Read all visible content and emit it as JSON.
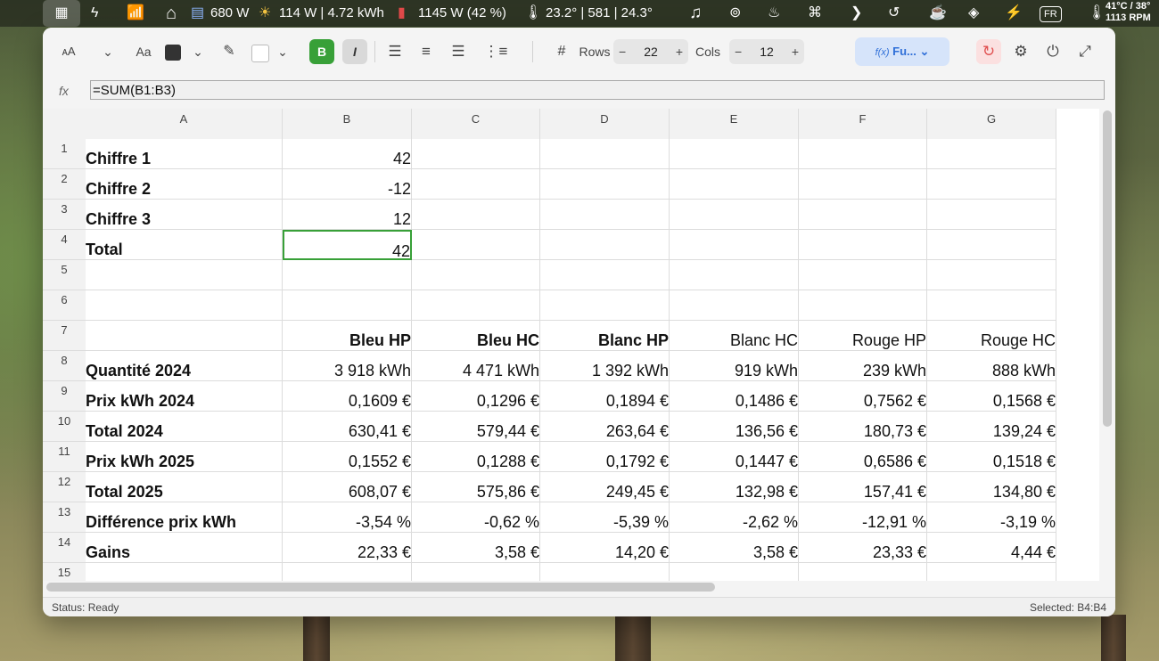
{
  "menubar": {
    "items": [
      {
        "name": "spreadsheet-app-icon",
        "glyph": "▦"
      },
      {
        "name": "slash-app-icon",
        "glyph": "ϟ"
      },
      {
        "name": "wifi-icon",
        "glyph": "📶"
      },
      {
        "name": "solar-house-icon",
        "glyph": "⌂"
      },
      {
        "text": "680 W"
      },
      {
        "name": "sun-icon",
        "glyph": "☀"
      },
      {
        "text": "114 W | 4.72 kWh"
      },
      {
        "name": "battery-icon",
        "glyph": "▮"
      },
      {
        "text": "1145 W (42 %)"
      },
      {
        "name": "thermometer-icon",
        "glyph": "🌡"
      },
      {
        "text": "23.2° | 581 | 24.3°"
      },
      {
        "name": "music-icon",
        "glyph": "♫"
      },
      {
        "name": "radio-icon",
        "glyph": "⊚"
      },
      {
        "name": "flame-icon",
        "glyph": "♨"
      },
      {
        "name": "command-icon",
        "glyph": "⌘"
      },
      {
        "name": "chevron-right-icon",
        "glyph": "❯"
      },
      {
        "name": "history-icon",
        "glyph": "↺"
      },
      {
        "name": "coffee-icon",
        "glyph": "☕"
      },
      {
        "name": "layers-icon",
        "glyph": "◈"
      },
      {
        "name": "bolt-icon",
        "glyph": "⚡"
      }
    ],
    "keyboard_label": "FR",
    "temp_line1": "41°C / 38°",
    "temp_line2": "1113 RPM"
  },
  "toolbar": {
    "font_size_icon": "ᴀA",
    "font_icon": "Aa",
    "text_color": "#333333",
    "fill_color": "#ffffff",
    "bold_label": "B",
    "italic_label": "I",
    "rows_label": "Rows",
    "rows_value": "22",
    "cols_label": "Cols",
    "cols_value": "12",
    "function_label": "Fu...",
    "function_prefix": "f(x)"
  },
  "formula_bar": {
    "label": "fx",
    "value": "=SUM(B1:B3)"
  },
  "grid": {
    "columns": [
      "A",
      "B",
      "C",
      "D",
      "E",
      "F",
      "G"
    ],
    "rows": [
      {
        "n": "1",
        "cells": [
          "Chiffre 1",
          "42",
          "",
          "",
          "",
          "",
          ""
        ]
      },
      {
        "n": "2",
        "cells": [
          "Chiffre 2",
          "-12",
          "",
          "",
          "",
          "",
          ""
        ]
      },
      {
        "n": "3",
        "cells": [
          "Chiffre 3",
          "12",
          "",
          "",
          "",
          "",
          ""
        ]
      },
      {
        "n": "4",
        "cells": [
          "Total",
          "42",
          "",
          "",
          "",
          "",
          ""
        ]
      },
      {
        "n": "5",
        "cells": [
          "",
          "",
          "",
          "",
          "",
          "",
          ""
        ]
      },
      {
        "n": "6",
        "cells": [
          "",
          "",
          "",
          "",
          "",
          "",
          ""
        ]
      },
      {
        "n": "7",
        "cells": [
          "",
          "Bleu HP",
          "Bleu HC",
          "Blanc HP",
          "Blanc HC",
          "Rouge HP",
          "Rouge HC"
        ]
      },
      {
        "n": "8",
        "cells": [
          "Quantité 2024",
          "3 918 kWh",
          "4 471 kWh",
          "1 392 kWh",
          "919 kWh",
          "239 kWh",
          "888 kWh"
        ]
      },
      {
        "n": "9",
        "cells": [
          "Prix kWh 2024",
          "0,1609 €",
          "0,1296 €",
          "0,1894 €",
          "0,1486 €",
          "0,7562 €",
          "0,1568 €"
        ]
      },
      {
        "n": "10",
        "cells": [
          "Total 2024",
          "630,41 €",
          "579,44 €",
          "263,64 €",
          "136,56 €",
          "180,73 €",
          "139,24 €"
        ]
      },
      {
        "n": "11",
        "cells": [
          "Prix kWh 2025",
          "0,1552 €",
          "0,1288 €",
          "0,1792 €",
          "0,1447 €",
          "0,6586 €",
          "0,1518 €"
        ]
      },
      {
        "n": "12",
        "cells": [
          "Total 2025",
          "608,07 €",
          "575,86 €",
          "249,45 €",
          "132,98 €",
          "157,41 €",
          "134,80 €"
        ]
      },
      {
        "n": "13",
        "cells": [
          "Différence prix kWh",
          "-3,54 %",
          "-0,62 %",
          "-5,39 %",
          "-2,62 %",
          "-12,91 %",
          "-3,19 %"
        ]
      },
      {
        "n": "14",
        "cells": [
          "Gains",
          "22,33 €",
          "3,58 €",
          "14,20 €",
          "3,58 €",
          "23,33 €",
          "4,44 €"
        ]
      },
      {
        "n": "15",
        "cells": [
          "",
          "",
          "",
          "",
          "",
          "",
          ""
        ]
      }
    ]
  },
  "status": {
    "left": "Status: Ready",
    "right": "Selected: B4:B4"
  }
}
